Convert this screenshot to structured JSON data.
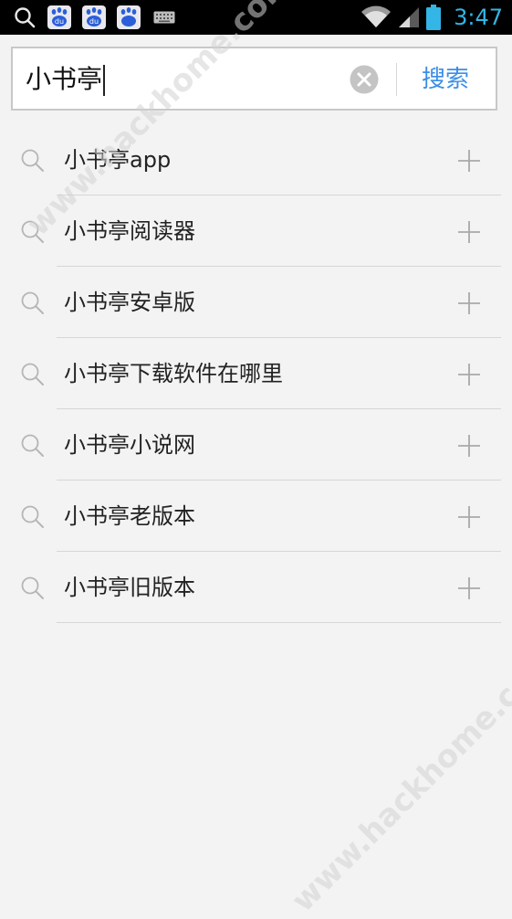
{
  "status_bar": {
    "time": "3:47",
    "notification_icons": [
      "search-icon",
      "baidu-paw-icon",
      "baidu-paw-icon",
      "baidu-paw-icon",
      "keyboard-icon"
    ],
    "accent_color": "#33b5e5"
  },
  "search": {
    "query": "小书亭",
    "button_label": "搜索",
    "button_color": "#3b8ee6"
  },
  "suggestions": [
    {
      "text": "小书亭app"
    },
    {
      "text": "小书亭阅读器"
    },
    {
      "text": "小书亭安卓版"
    },
    {
      "text": "小书亭下载软件在哪里"
    },
    {
      "text": "小书亭小说网"
    },
    {
      "text": "小书亭老版本"
    },
    {
      "text": "小书亭旧版本"
    }
  ],
  "watermark": {
    "text": "www.hackhome.com"
  }
}
